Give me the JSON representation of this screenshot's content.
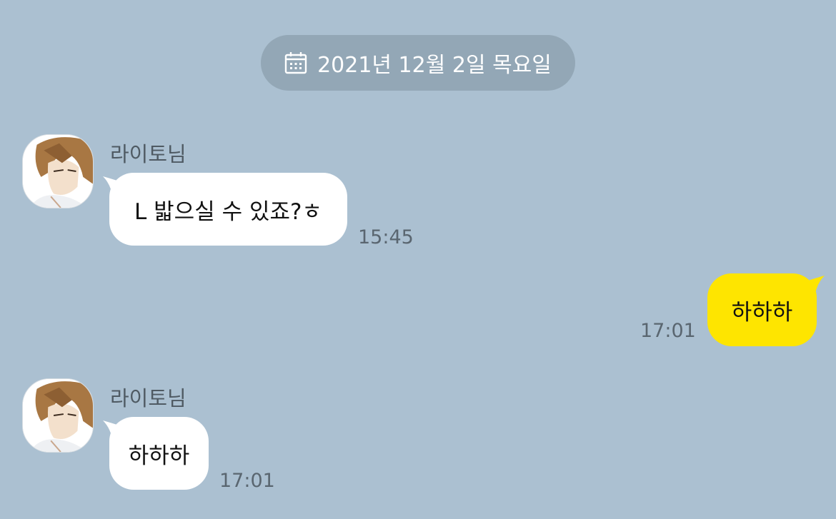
{
  "date_divider": {
    "icon": "calendar-icon",
    "text": "2021년 12월 2일 목요일"
  },
  "colors": {
    "background": "#abc0d1",
    "date_pill": "#93a7b6",
    "incoming_bubble": "#ffffff",
    "outgoing_bubble": "#fee500"
  },
  "messages": [
    {
      "direction": "incoming",
      "sender": "라이토님",
      "text": "L 밟으실 수 있죠?ㅎ",
      "time": "15:45"
    },
    {
      "direction": "outgoing",
      "text": "하하하",
      "time": "17:01"
    },
    {
      "direction": "incoming",
      "sender": "라이토님",
      "text": "하하하",
      "time": "17:01"
    }
  ]
}
